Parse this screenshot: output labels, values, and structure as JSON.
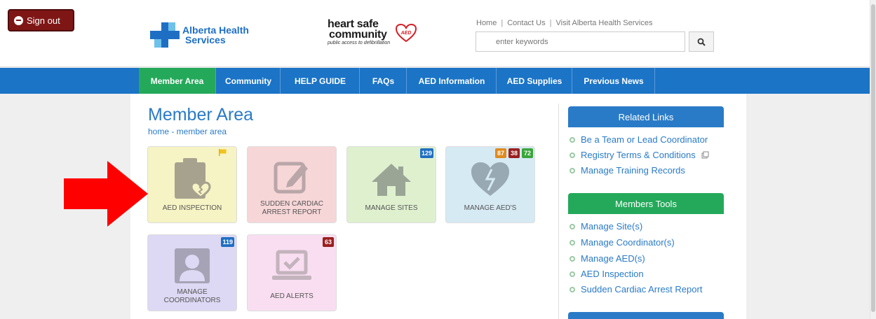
{
  "signout": {
    "label": "Sign out"
  },
  "brand": {
    "ahs_line1": "Alberta Health",
    "ahs_line2": "Services",
    "hs_line1": "heart safe",
    "hs_line2": "community",
    "hs_badge": "AED",
    "hs_tagline": "public access to defibrillation"
  },
  "toplinks": [
    "Home",
    "Contact Us",
    "Visit Alberta Health Services"
  ],
  "search": {
    "placeholder": "enter keywords",
    "icon": "search-icon"
  },
  "nav": [
    "Member Area",
    "Community",
    "HELP GUIDE",
    "FAQs",
    "AED Information",
    "AED Supplies",
    "Previous News"
  ],
  "page": {
    "title": "Member Area",
    "breadcrumb": "home - member area"
  },
  "tiles": [
    {
      "label": "AED INSPECTION",
      "icon": "clipboard-heart-icon",
      "bg": "#f6f3c4",
      "flag": true
    },
    {
      "label": "SUDDEN CARDIAC ARREST REPORT",
      "icon": "edit-icon",
      "bg": "#f7d6d8"
    },
    {
      "label": "MANAGE SITES",
      "icon": "home-icon",
      "bg": "#dff0cf",
      "badges": [
        "129"
      ]
    },
    {
      "label": "MANAGE AED'S",
      "icon": "broken-heart-icon",
      "bg": "#d6eaf4",
      "badges": [
        "87",
        "38",
        "72"
      ]
    },
    {
      "label": "MANAGE COORDINATORS",
      "icon": "user-icon",
      "bg": "#ddd8f3",
      "badges": [
        "119"
      ]
    },
    {
      "label": "AED ALERTS",
      "icon": "laptop-check-icon",
      "bg": "#f9def1",
      "badges": [
        "63"
      ]
    }
  ],
  "colors": {
    "nav_blue": "#1b74c6",
    "active_green": "#24a95a",
    "badge_blue": "#1f6fc2",
    "badge_orange": "#e08a1e",
    "badge_darkred": "#9a1f1f",
    "badge_green": "#3aa53a",
    "arrow_red": "#ff0000"
  },
  "sidebar": {
    "related_title": "Related Links",
    "related": [
      "Be a Team or Lead Coordinator",
      "Registry Terms & Conditions",
      "Manage Training Records"
    ],
    "tools_title": "Members Tools",
    "tools": [
      "Manage Site(s)",
      "Manage Coordinator(s)",
      "Manage AED(s)",
      "AED Inspection",
      "Sudden Cardiac Arrest Report"
    ]
  }
}
